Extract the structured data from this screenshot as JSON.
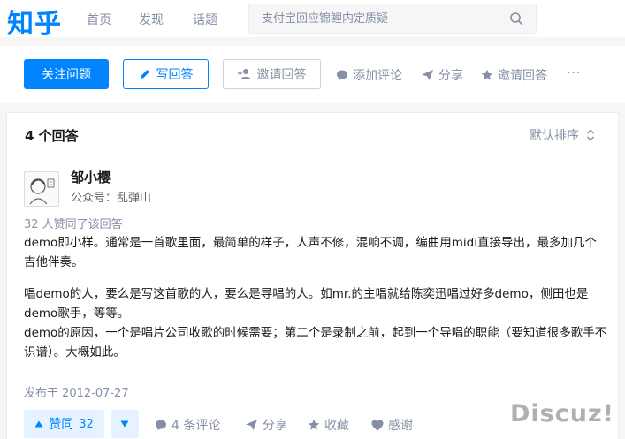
{
  "header": {
    "logo": "知乎",
    "nav": [
      "首页",
      "发现",
      "话题"
    ],
    "search_placeholder": "支付宝回应锦鲤内定质疑"
  },
  "question_actions": {
    "follow": "关注问题",
    "write_answer": "写回答",
    "invite_answer": "邀请回答",
    "add_comment": "添加评论",
    "share": "分享",
    "invite_answer_2": "邀请回答",
    "more": "···"
  },
  "answers": {
    "count_label": "4  个回答",
    "sort_label": "默认排序"
  },
  "answer": {
    "author_name": "邹小樱",
    "author_bio": "公众号：乱弹山",
    "votes_note": "32  人赞同了该回答",
    "paragraphs": [
      "demo即小样。通常是一首歌里面，最简单的样子，人声不修，混响不调，编曲用midi直接导出，最多加几个吉他伴奏。",
      "唱demo的人，要么是写这首歌的人，要么是导唱的人。如mr.的主唱就给陈奕迅唱过好多demo，侧田也是demo歌手，等等。",
      "demo的原因，一个是唱片公司收歌的时候需要；第二个是录制之前，起到一个导唱的职能（要知道很多歌手不识谱）。大概如此。"
    ],
    "date": "发布于  2012-07-27",
    "vote_up_label": "赞同",
    "vote_count": "32",
    "comments": "4  条评论",
    "share": "分享",
    "collect": "收藏",
    "thanks": "感谢"
  },
  "watermark": "Discuz!",
  "colors": {
    "brand": "#0084ff",
    "muted": "#8590a6",
    "background": "#f6f6f6"
  }
}
